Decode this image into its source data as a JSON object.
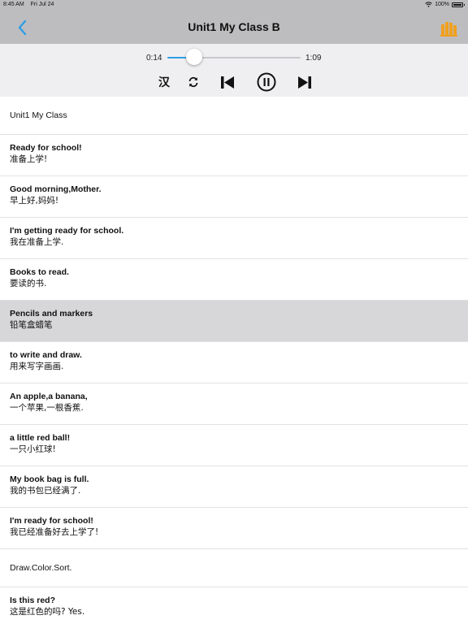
{
  "status_bar": {
    "time": "8:45 AM",
    "date": "Fri Jul 24",
    "battery": "100%",
    "battery_level": 1.0,
    "wifi_icon": "wifi-icon"
  },
  "nav": {
    "title": "Unit1 My Class B",
    "back_icon": "chevron-left-icon",
    "books_icon": "books-icon",
    "accent": "#2c9ee5",
    "books_color": "#f0a020"
  },
  "player": {
    "current_time": "0:14",
    "duration": "1:09",
    "progress": 0.2,
    "han_label": "汉",
    "controls": [
      "loop-icon",
      "previous-icon",
      "pause-icon",
      "next-icon"
    ]
  },
  "sentences": [
    {
      "en": "Unit1 My Class",
      "zh": ""
    },
    {
      "en": "Ready for school!",
      "zh": "准备上学!"
    },
    {
      "en": "Good morning,Mother.",
      "zh": "早上好,妈妈!"
    },
    {
      "en": "I'm getting ready for school.",
      "zh": "我在准备上学."
    },
    {
      "en": "Books to read.",
      "zh": "要读的书."
    },
    {
      "en": "Pencils and markers",
      "zh": "铅笔盒蜡笔",
      "selected": true
    },
    {
      "en": "to write and draw.",
      "zh": "用来写字画画."
    },
    {
      "en": "An apple,a banana,",
      "zh": "一个苹果,一根香蕉."
    },
    {
      "en": "a little red ball!",
      "zh": "一只小红球!"
    },
    {
      "en": "My book bag is full.",
      "zh": "我的书包已经满了."
    },
    {
      "en": "I'm ready for school!",
      "zh": "我已经准备好去上学了!"
    },
    {
      "en": "Draw.Color.Sort.",
      "zh": ""
    },
    {
      "en": "Is this red?",
      "zh": "这是红色的吗? Yes."
    }
  ]
}
